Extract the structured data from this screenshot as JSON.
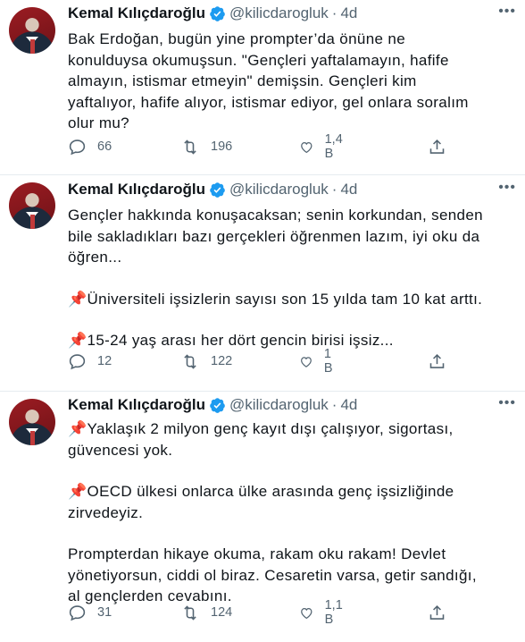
{
  "tweets": [
    {
      "author": {
        "name": "Kemal Kılıçdaroğlu",
        "handle": "@kilicdarogluk",
        "time": "4d"
      },
      "lines": [
        "Bak Erdoğan, bugün yine prompter’da önüne ne",
        "konulduysa okumuşsun. \"Gençleri yaftalamayın, hafife",
        "almayın, istismar etmeyin\" demişsin. Gençleri kim",
        "yaftalıyor, hafife alıyor, istismar ediyor, gel onlara soralım",
        "olur mu?"
      ],
      "stats": {
        "replies": "66",
        "retweets": "196",
        "likes": "1,4 B"
      }
    },
    {
      "author": {
        "name": "Kemal Kılıçdaroğlu",
        "handle": "@kilicdarogluk",
        "time": "4d"
      },
      "lines": [
        "Gençler hakkında konuşacaksan; senin korkundan, senden",
        "bile sakladıkları bazı gerçekleri öğrenmen lazım, iyi oku da",
        "öğren...",
        "",
        "📌Üniversiteli işsizlerin sayısı son 15 yılda tam 10 kat arttı.",
        "",
        "📌15-24 yaş arası her dört gencin birisi işsiz..."
      ],
      "stats": {
        "replies": "12",
        "retweets": "122",
        "likes": "1 B"
      }
    },
    {
      "author": {
        "name": "Kemal Kılıçdaroğlu",
        "handle": "@kilicdarogluk",
        "time": "4d"
      },
      "lines": [
        "📌Yaklaşık 2 milyon genç kayıt dışı çalışıyor, sigortası,",
        "güvencesi yok.",
        "",
        "📌OECD ülkesi onlarca ülke arasında genç işsizliğinde",
        "zirvedeyiz.",
        "",
        "Prompterdan hikaye okuma, rakam oku rakam! Devlet",
        "yönetiyorsun, ciddi ol biraz. Cesaretin varsa, getir sandığı,",
        "al gençlerden cevabını."
      ],
      "stats": {
        "replies": "31",
        "retweets": "124",
        "likes": "1,1 B"
      }
    }
  ],
  "icons": [
    "reply-icon",
    "retweet-icon",
    "like-icon",
    "share-icon",
    "verified-icon",
    "more-icon"
  ],
  "colors": {
    "text": "#0f1419",
    "secondary": "#536471",
    "verified": "#1d9bf0",
    "divider": "#e6ecf0"
  }
}
